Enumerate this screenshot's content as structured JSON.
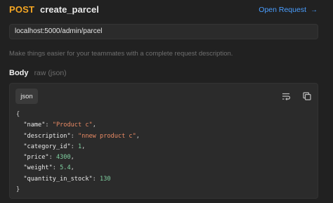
{
  "request": {
    "method": "POST",
    "name": "create_parcel",
    "open_label": "Open Request",
    "open_arrow": "→",
    "url": "localhost:5000/admin/parcel",
    "description_placeholder": "Make things easier for your teammates with a complete request description."
  },
  "body": {
    "title": "Body",
    "mode": "raw (json)",
    "language_tab": "json",
    "icons": [
      "wrap-text-icon",
      "copy-icon"
    ],
    "code": {
      "open": "{",
      "close": "}",
      "fields": [
        {
          "key": "\"name\"",
          "value": "\"Product c\"",
          "type": "string",
          "sep": ","
        },
        {
          "key": "\"description\"",
          "value": "\"nnew product c\"",
          "type": "string",
          "sep": ","
        },
        {
          "key": "\"category_id\"",
          "value": "1",
          "type": "number",
          "sep": ","
        },
        {
          "key": "\"price\"",
          "value": "4300",
          "type": "number",
          "sep": ","
        },
        {
          "key": "\"weight\"",
          "value": "5.4",
          "type": "number",
          "sep": ","
        },
        {
          "key": "\"quantity_in_stock\"",
          "value": "130",
          "type": "number",
          "sep": ""
        }
      ]
    }
  },
  "colors": {
    "background": "#212121",
    "method_post": "#f5a623",
    "link_blue": "#4a9eff",
    "string_value": "#e98a64",
    "number_value": "#7fd0a0"
  }
}
